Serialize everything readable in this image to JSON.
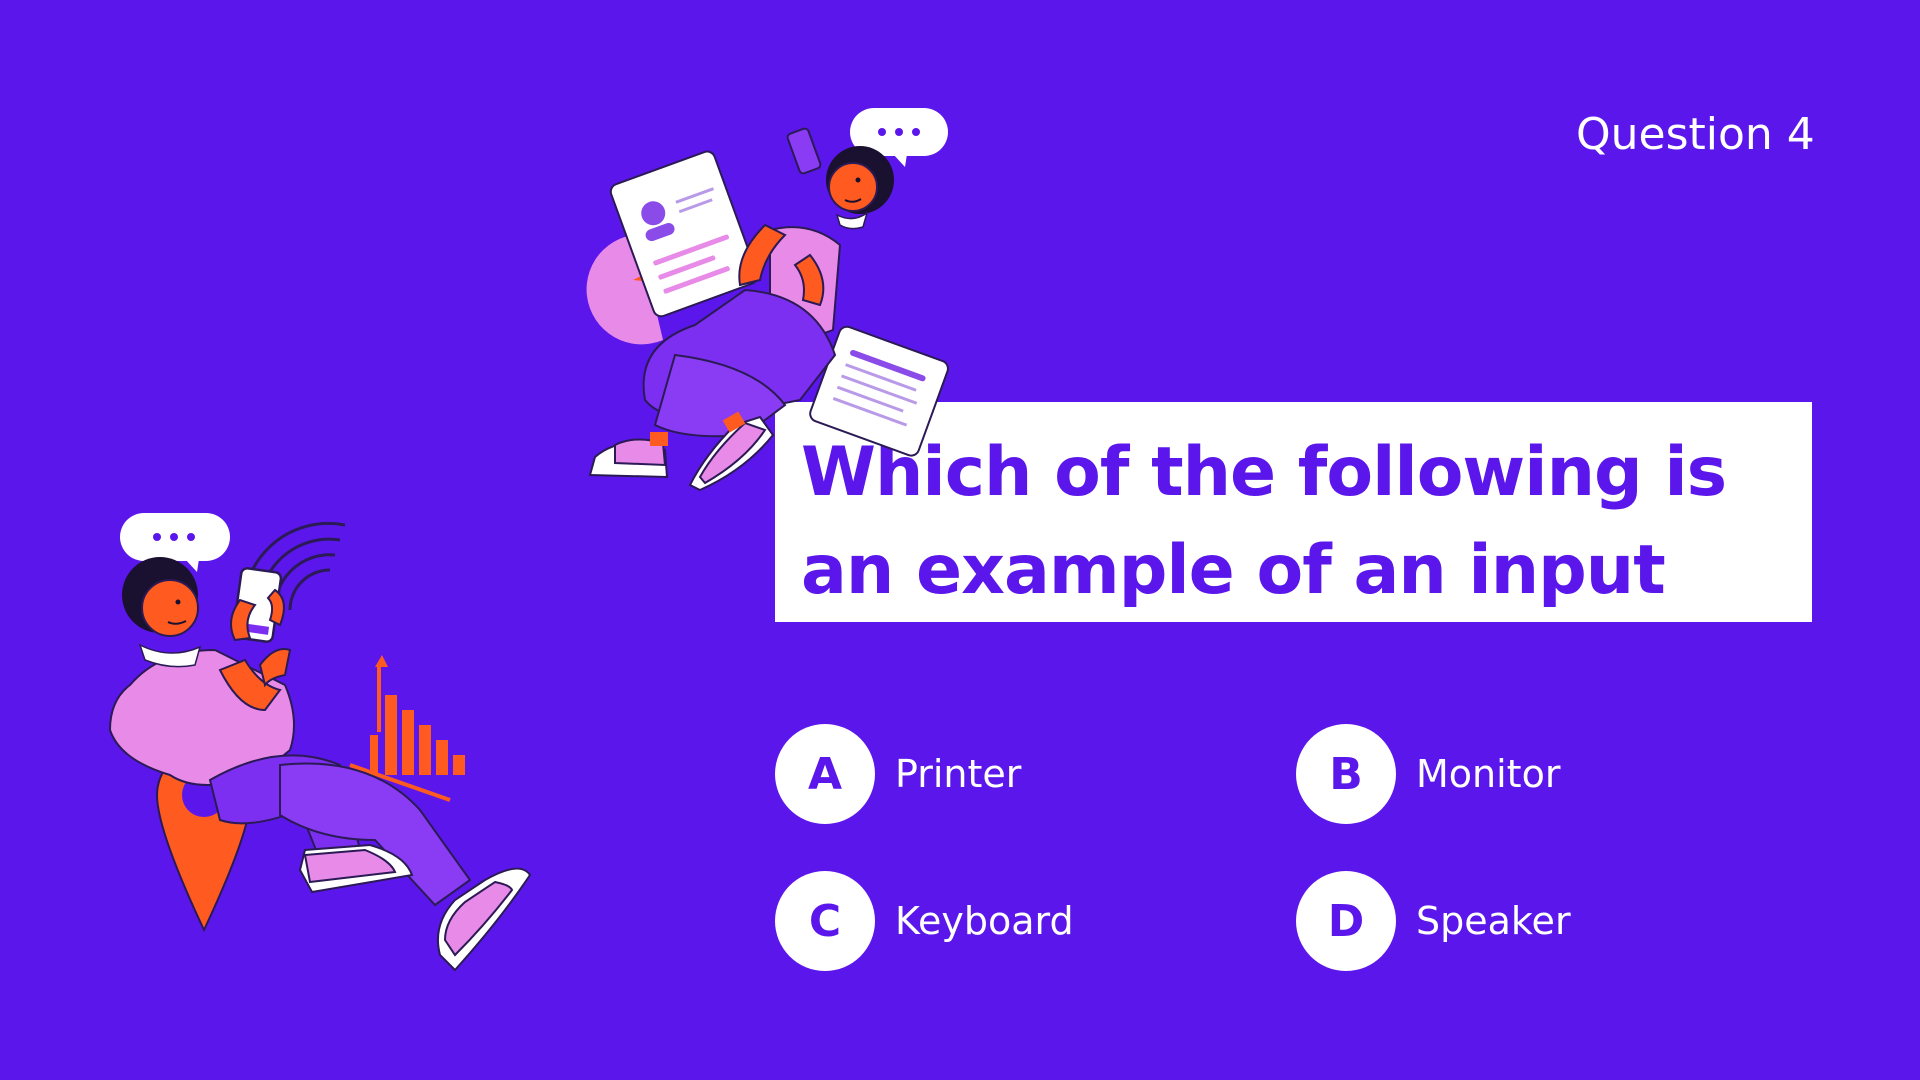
{
  "header": {
    "question_number": "Question 4"
  },
  "question": {
    "text": "Which of the following is an example of an input device?"
  },
  "options": [
    {
      "letter": "A",
      "label": "Printer"
    },
    {
      "letter": "B",
      "label": "Monitor"
    },
    {
      "letter": "C",
      "label": "Keyboard"
    },
    {
      "letter": "D",
      "label": "Speaker"
    }
  ],
  "colors": {
    "background": "#5b17eb",
    "accent_pink": "#e88ae8",
    "accent_orange": "#ff5a1f",
    "white": "#ffffff"
  },
  "icons": {
    "top_illustration": "woman-with-phone-illustration",
    "bottom_illustration": "man-with-phone-illustration",
    "speech_bubble": "speech-bubble-icon",
    "location_pin": "location-pin-icon",
    "bar_chart": "bar-chart-icon",
    "wifi": "wifi-icon"
  }
}
